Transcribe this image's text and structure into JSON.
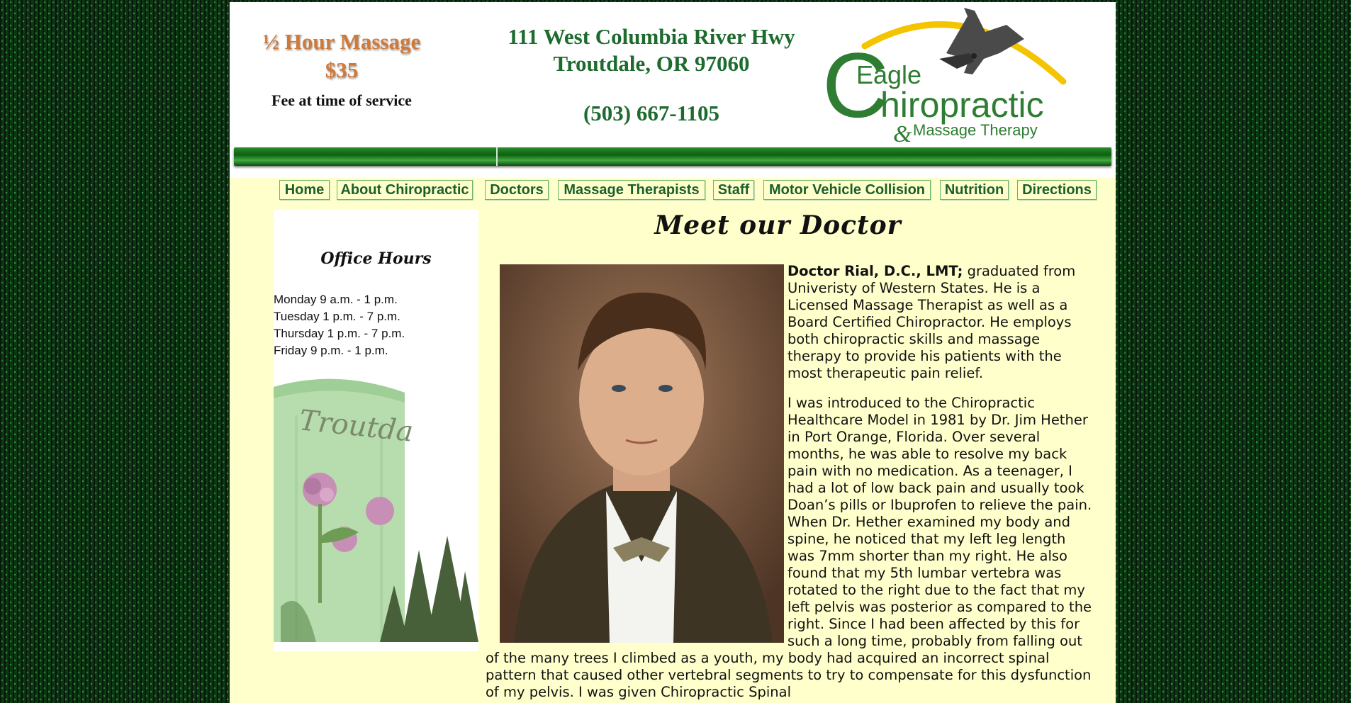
{
  "header": {
    "promo_title": "½ Hour Massage",
    "promo_price": "$35",
    "promo_note": "Fee at time of service",
    "address_line1": "111 West Columbia River Hwy",
    "address_line2": "Troutdale, OR 97060",
    "phone": "(503) 667-1105",
    "logo": {
      "word1": "Eagle",
      "word2": "hiropractic",
      "letter_c": "C",
      "tagline_amp": "&",
      "tagline": "Massage Therapy",
      "icon": "eagle-logo"
    }
  },
  "nav": {
    "items": [
      {
        "label": "Home"
      },
      {
        "label": "About Chiropractic"
      },
      {
        "label": "Doctors"
      },
      {
        "label": "Massage Therapists"
      },
      {
        "label": "Staff"
      },
      {
        "label": "Motor Vehicle Collision"
      },
      {
        "label": "Nutrition"
      },
      {
        "label": "Directions"
      }
    ]
  },
  "sidebar": {
    "title": "Office Hours",
    "hours": [
      "Monday 9 a.m. - 1 p.m.",
      "Tuesday 1 p.m. - 7 p.m.",
      "Thursday 1 p.m. - 7 p.m.",
      "Friday 9 p.m. - 1 p.m."
    ],
    "tower_text": "Troutda"
  },
  "main": {
    "heading": "Meet our Doctor",
    "bio_name": "Doctor Rial, D.C., LMT;",
    "bio_p1": " graduated from Univeristy of Western States.  He is a Licensed Massage Therapist as well as a Board Certified Chiropractor.  He employs both chiropractic skills and massage therapy to provide his patients with the most therapeutic pain relief.",
    "bio_p2": "I was introduced to the Chiropractic Healthcare Model in 1981 by Dr. Jim Hether in Port Orange, Florida.  Over several months, he was able to resolve my back pain with no medication.  As a teenager, I had a lot of low back pain and usually took Doan’s pills or Ibuprofen to relieve the pain.  When Dr. Hether examined my body and spine, he noticed that my left leg length was 7mm shorter than my right.  He also found that my 5th lumbar vertebra was rotated to the right due to the fact that my left pelvis was posterior as compared to the right.  Since I had been affected by this for such a long time, probably from falling out of the many trees I climbed as a youth, my body had acquired an incorrect spinal pattern that caused other vertebral segments to try to compensate for this dysfunction of my pelvis.  I was given Chiropractic Spinal"
  },
  "colors": {
    "page_bg": "#ffffcc",
    "brand_green": "#1d6b2e",
    "accent_orange": "#d07a3a",
    "logo_yellow": "#f5c400"
  }
}
